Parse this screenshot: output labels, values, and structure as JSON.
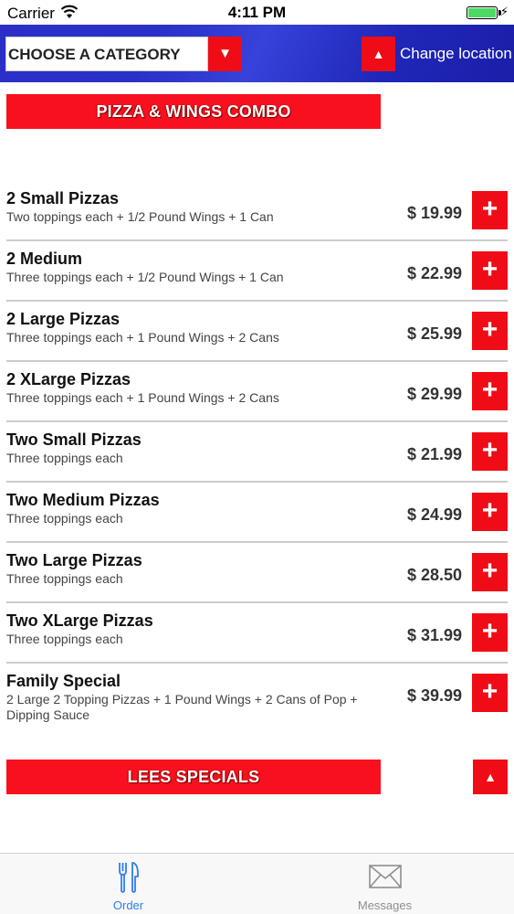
{
  "status_bar": {
    "carrier": "Carrier",
    "time": "4:11 PM"
  },
  "header": {
    "category_label": "CHOOSE A CATEGORY",
    "category_arrow": "▼",
    "location_arrow": "▲",
    "change_location": "Change location"
  },
  "sections": [
    {
      "title": "PIZZA & WINGS COMBO"
    },
    {
      "title": "LEES SPECIALS",
      "arrow": "▲"
    }
  ],
  "menu_items": [
    {
      "name": "2 Small Pizzas",
      "description": "Two toppings each + 1/2 Pound Wings + 1 Can",
      "price": "$ 19.99"
    },
    {
      "name": "2 Medium",
      "description": "Three toppings each + 1/2 Pound Wings + 1 Can",
      "price": "$ 22.99"
    },
    {
      "name": "2 Large Pizzas",
      "description": "Three toppings each + 1 Pound Wings + 2 Cans",
      "price": "$ 25.99"
    },
    {
      "name": "2 XLarge Pizzas",
      "description": "Three toppings each + 1 Pound Wings + 2 Cans",
      "price": "$ 29.99"
    },
    {
      "name": "Two Small Pizzas",
      "description": "Three toppings each",
      "price": "$ 21.99"
    },
    {
      "name": "Two Medium Pizzas",
      "description": "Three toppings each",
      "price": "$ 24.99"
    },
    {
      "name": "Two Large Pizzas",
      "description": "Three toppings each",
      "price": "$ 28.50"
    },
    {
      "name": "Two XLarge Pizzas",
      "description": "Three toppings each",
      "price": "$ 31.99"
    },
    {
      "name": "Family Special",
      "description": "2 Large 2 Topping Pizzas + 1 Pound Wings + 2 Cans of Pop + Dipping Sauce",
      "price": "$ 39.99"
    }
  ],
  "add_label": "+",
  "tabs": [
    {
      "label": "Order",
      "icon": "fork-knife-icon",
      "active": true
    },
    {
      "label": "Messages",
      "icon": "envelope-icon",
      "active": false
    }
  ],
  "colors": {
    "accent_red": "#f00c16",
    "header_blue": "#2b2fc8",
    "active_tab": "#2f7cf6",
    "inactive_tab": "#8e8e93"
  }
}
